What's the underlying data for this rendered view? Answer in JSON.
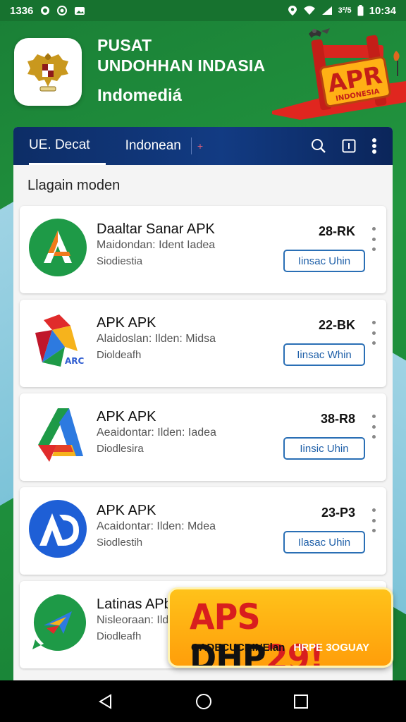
{
  "status_bar": {
    "left_text": "1336",
    "battery_text": "3²/5",
    "time": "10:34"
  },
  "header": {
    "title_line1": "PUSAT",
    "title_line2": "UNDOHHAN INDASIA",
    "subtitle": "Indomediá",
    "banner_text": "APR",
    "banner_sub": "INDONESIA"
  },
  "tabs": {
    "items": [
      {
        "label": "UE. Decat"
      },
      {
        "label": "Indonean"
      }
    ],
    "star": "+"
  },
  "section": {
    "title": "Llagain moden"
  },
  "apps": [
    {
      "name": "Daaltar Sanar APK",
      "desc1": "Maidondan: Ident Iadea",
      "desc2": "Siodiestia",
      "size": "28-RK",
      "button": "Iinsac Uhin",
      "icon": "android-a-icon"
    },
    {
      "name": "APK APK",
      "desc1": "Alaidoslan: Ilden: Midsa",
      "desc2": "Dioldeafh",
      "size": "22-BK",
      "button": "Iinsac Whin",
      "icon": "colorful-a-icon"
    },
    {
      "name": "APK APK",
      "desc1": "Aeaidontar: Ilden: Iadea",
      "desc2": "Diodlesira",
      "size": "38-R8",
      "button": "Iinsic Uhin",
      "icon": "google-a-icon"
    },
    {
      "name": "APK APK",
      "desc1": "Acaidontar: Ilden: Mdea",
      "desc2": "Siodlestih",
      "size": "23-P3",
      "button": "Ilasac Uhin",
      "icon": "blue-ad-icon"
    },
    {
      "name": "Latinas APbr",
      "desc1": "Nisleoraan: Ilde",
      "desc2": "Diodleafh",
      "size": "",
      "button": "",
      "icon": "green-arrow-icon"
    }
  ],
  "promo": {
    "title_red": "APS",
    "title_black": "DHP",
    "title_num": "29!",
    "sub1": "GADECUCRINElan",
    "sub2": "HRPE 3OGUAY"
  },
  "colors": {
    "green_bg": "#1f8a3a",
    "tab_blue": "#123b83",
    "button_blue": "#2a6fb5",
    "promo_orange": "#ffb015",
    "promo_red": "#d81e1e"
  }
}
